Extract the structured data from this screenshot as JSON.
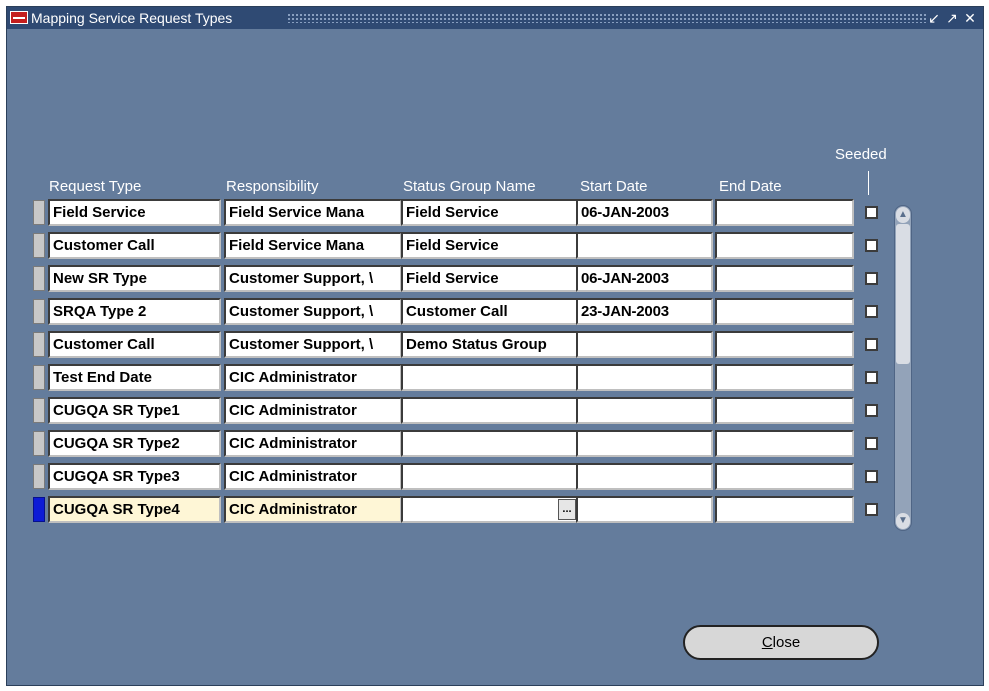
{
  "window": {
    "title": "Mapping Service Request Types",
    "controls": [
      "minimize",
      "maximize",
      "close"
    ]
  },
  "columns": {
    "request_type": "Request Type",
    "responsibility": "Responsibility",
    "status_group": "Status Group Name",
    "start_date": "Start Date",
    "end_date": "End Date",
    "seeded": "Seeded"
  },
  "rows": [
    {
      "request_type": "Field Service",
      "responsibility": "Field Service Mana",
      "status_group": "Field Service",
      "start_date": "06-JAN-2003",
      "end_date": "",
      "seeded": false
    },
    {
      "request_type": "Customer Call",
      "responsibility": "Field Service Mana",
      "status_group": "Field Service",
      "start_date": "",
      "end_date": "",
      "seeded": false
    },
    {
      "request_type": "New SR Type",
      "responsibility": "Customer Support, \\",
      "status_group": "Field Service",
      "start_date": "06-JAN-2003",
      "end_date": "",
      "seeded": false
    },
    {
      "request_type": "SRQA Type 2",
      "responsibility": "Customer Support, \\",
      "status_group": "Customer Call",
      "start_date": "23-JAN-2003",
      "end_date": "",
      "seeded": false
    },
    {
      "request_type": "Customer Call",
      "responsibility": "Customer Support, \\",
      "status_group": "Demo Status Group",
      "start_date": "",
      "end_date": "",
      "seeded": false
    },
    {
      "request_type": "Test End Date",
      "responsibility": "CIC Administrator",
      "status_group": "",
      "start_date": "",
      "end_date": "",
      "seeded": false
    },
    {
      "request_type": "CUGQA SR Type1",
      "responsibility": "CIC Administrator",
      "status_group": "",
      "start_date": "",
      "end_date": "",
      "seeded": false
    },
    {
      "request_type": "CUGQA SR Type2",
      "responsibility": "CIC Administrator",
      "status_group": "",
      "start_date": "",
      "end_date": "",
      "seeded": false
    },
    {
      "request_type": "CUGQA SR Type3",
      "responsibility": "CIC Administrator",
      "status_group": "",
      "start_date": "",
      "end_date": "",
      "seeded": false
    },
    {
      "request_type": "CUGQA SR Type4",
      "responsibility": "CIC Administrator",
      "status_group": "",
      "start_date": "",
      "end_date": "",
      "seeded": false,
      "current": true
    }
  ],
  "lov_button_label": "...",
  "close_button": {
    "mnemonic": "C",
    "rest": "lose"
  },
  "colors": {
    "canvas": "#647c9c",
    "titlebar": "#2f4a73",
    "current_row_highlight": "#fef6d6",
    "current_row_indicator": "#0c1bd6"
  },
  "icons": {
    "minimize": "minimize-icon",
    "maximize": "maximize-icon",
    "close": "close-icon"
  }
}
